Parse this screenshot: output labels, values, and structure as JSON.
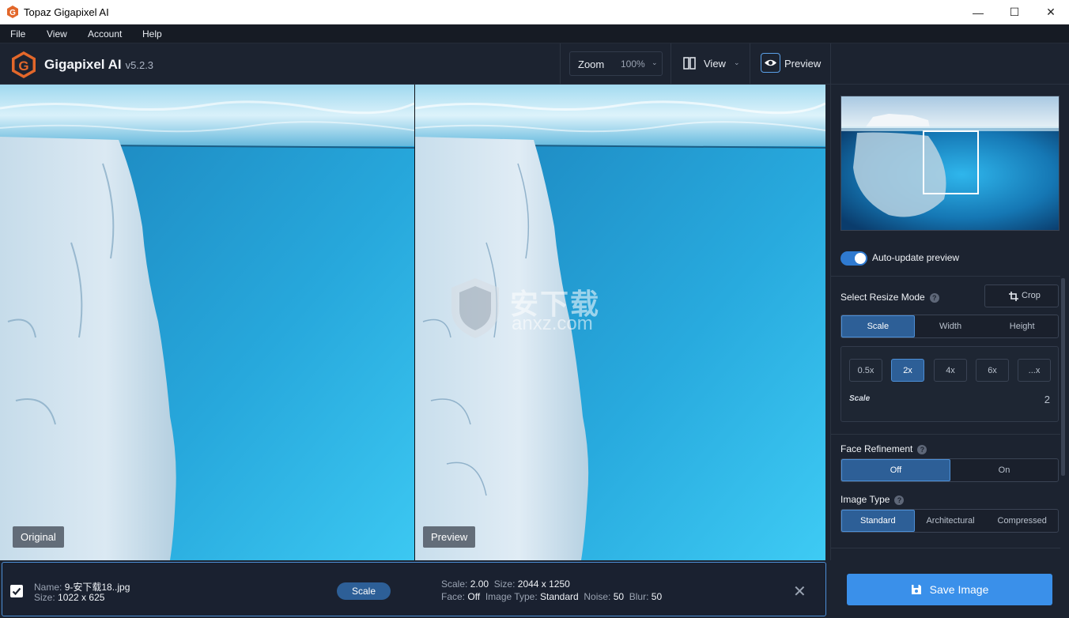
{
  "window": {
    "title": "Topaz Gigapixel AI"
  },
  "menu": {
    "file": "File",
    "view": "View",
    "account": "Account",
    "help": "Help"
  },
  "toolbar": {
    "brand": "Gigapixel AI",
    "version": "v5.2.3",
    "zoom_label": "Zoom",
    "zoom_value": "100%",
    "view_label": "View",
    "preview_label": "Preview"
  },
  "panes": {
    "left_label": "Original",
    "right_label": "Preview"
  },
  "watermark": {
    "cn": "安下载",
    "en": "anxz.com"
  },
  "sidebar": {
    "auto_update": "Auto-update preview",
    "resize_mode_title": "Select Resize Mode",
    "crop_label": "Crop",
    "resize_modes": [
      "Scale",
      "Width",
      "Height"
    ],
    "scale_options": [
      "0.5x",
      "2x",
      "4x",
      "6x",
      "...x"
    ],
    "scale_label": "Scale",
    "scale_value": "2",
    "face_title": "Face Refinement",
    "face_options": [
      "Off",
      "On"
    ],
    "image_type_title": "Image Type",
    "image_types": [
      "Standard",
      "Architectural",
      "Compressed"
    ]
  },
  "file": {
    "name_key": "Name:",
    "name": "9-安下载18..jpg",
    "size_key": "Size:",
    "size": "1022 x 625",
    "mode_pill": "Scale",
    "scale_key": "Scale:",
    "scale": "2.00",
    "out_size_key": "Size:",
    "out_size": "2044 x 1250",
    "face_key": "Face:",
    "face": "Off",
    "type_key": "Image Type:",
    "type": "Standard",
    "noise_key": "Noise:",
    "noise": "50",
    "blur_key": "Blur:",
    "blur": "50"
  },
  "save_label": "Save Image"
}
